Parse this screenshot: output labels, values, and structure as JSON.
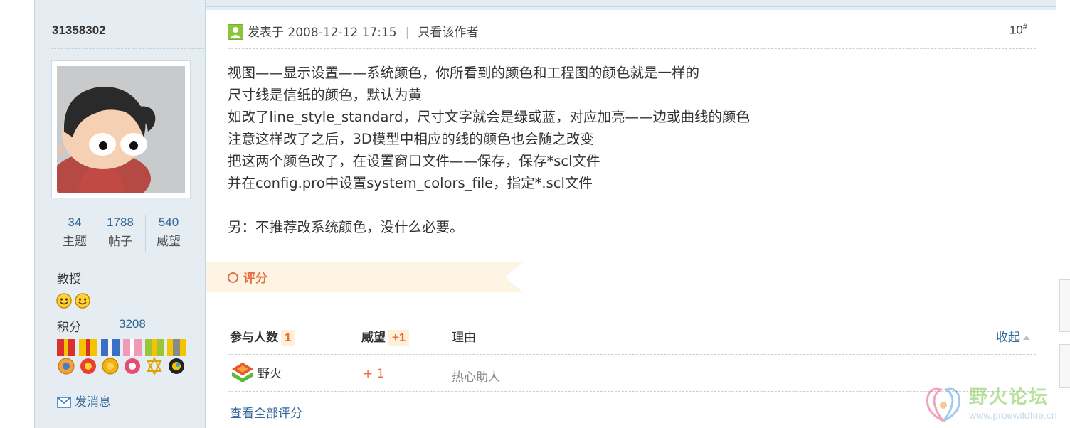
{
  "author": {
    "username": "31358302",
    "stats": [
      {
        "value": "34",
        "label": "主题"
      },
      {
        "value": "1788",
        "label": "帖子"
      },
      {
        "value": "540",
        "label": "威望"
      }
    ],
    "rank": "教授",
    "credit_label": "积分",
    "credit_value": "3208",
    "message_link": "发消息"
  },
  "post": {
    "posted_at": "发表于 2008-12-12 17:15",
    "only_author": "只看该作者",
    "floor": "10",
    "floor_mark": "#",
    "lines": [
      "视图——显示设置——系统颜色，你所看到的颜色和工程图的颜色就是一样的",
      "尺寸线是信纸的颜色，默认为黄",
      "如改了line_style_standard，尺寸文字就会是绿或蓝，对应加亮——边或曲线的颜色",
      "注意这样改了之后，3D模型中相应的线的颜色也会随之改变",
      "把这两个颜色改了，在设置窗口文件——保存，保存*scl文件",
      "并在config.pro中设置system_colors_file，指定*.scl文件",
      "",
      "另：不推荐改系统颜色，没什么必要。"
    ]
  },
  "rating": {
    "title": "评分",
    "participants_label": "参与人数",
    "participants_count": "1",
    "prestige_label": "威望",
    "prestige_total": "+1",
    "reason_label": "理由",
    "collapse_label": "收起",
    "rows": [
      {
        "user": "野火",
        "prestige": "+ 1",
        "reason": "热心助人"
      }
    ],
    "view_all": "查看全部评分"
  },
  "watermark": {
    "title": "野火论坛",
    "url": "www.proewildfire.cn"
  },
  "colors": {
    "sidebar_bg": "#e5edf2",
    "link": "#336699",
    "accent": "#e96b3f",
    "rating_banner": "#fdf4e4"
  }
}
